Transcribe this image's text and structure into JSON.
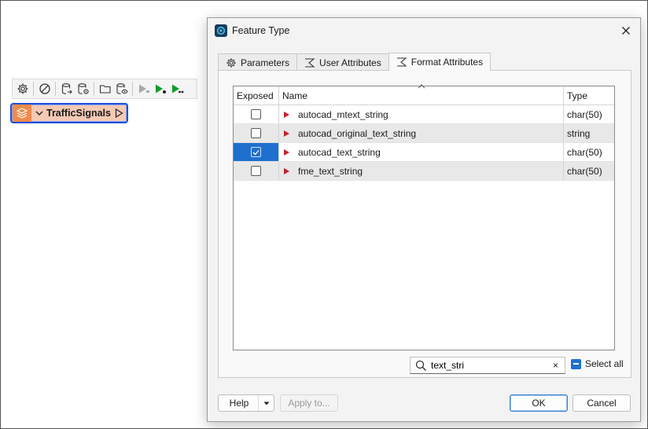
{
  "canvas": {
    "toolbar_icons": [
      "gear-icon",
      "disable-icon",
      "database-export-icon",
      "database-settings-icon",
      "folder-open-icon",
      "inspect-icon",
      "run-disabled-icon",
      "run-icon",
      "run-to-icon"
    ],
    "node": {
      "name": "TrafficSignals",
      "accent": "#f08a4b",
      "outline": "#1f4fd8"
    }
  },
  "dialog": {
    "title": "Feature Type",
    "tabs": [
      {
        "label": "Parameters",
        "icon": "gear-icon",
        "active": false
      },
      {
        "label": "User Attributes",
        "icon": "sigma-icon",
        "active": false
      },
      {
        "label": "Format Attributes",
        "icon": "sigma-icon",
        "active": true
      }
    ],
    "table": {
      "columns": [
        "Exposed",
        "Name",
        "Type"
      ],
      "rows": [
        {
          "exposed": false,
          "name": "autocad_mtext_string",
          "type": "char(50)"
        },
        {
          "exposed": false,
          "name": "autocad_original_text_string",
          "type": "string"
        },
        {
          "exposed": true,
          "name": "autocad_text_string",
          "type": "char(50)"
        },
        {
          "exposed": false,
          "name": "fme_text_string",
          "type": "char(50)"
        }
      ]
    },
    "search": {
      "value": "text_stri",
      "clear": "×"
    },
    "select_all_label": "Select all",
    "buttons": {
      "help": "Help",
      "apply": "Apply to...",
      "ok": "OK",
      "cancel": "Cancel"
    },
    "colors": {
      "selection": "#1f6fcf",
      "row_marker": "#c8202a"
    }
  }
}
